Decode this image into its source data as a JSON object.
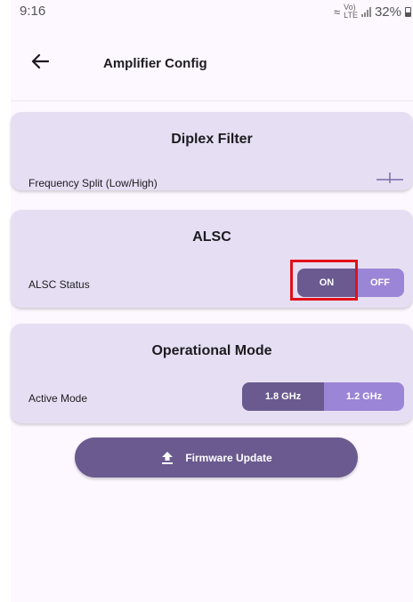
{
  "status_bar": {
    "time": "9:16",
    "network_top": "Vo)",
    "network_bottom": "LTE",
    "battery_percent": "32%"
  },
  "app_bar": {
    "title": "Amplifier Config",
    "back_icon": "arrow-left-icon"
  },
  "diplex": {
    "title": "Diplex Filter",
    "frequency_label": "Frequency Split (Low/High)"
  },
  "alsc": {
    "title": "ALSC",
    "status_label": "ALSC Status",
    "on_label": "ON",
    "off_label": "OFF",
    "selected": "ON"
  },
  "mode": {
    "title": "Operational Mode",
    "active_label": "Active Mode",
    "option_1": "1.8 GHz",
    "option_2": "1.2 GHz",
    "selected": "1.8 GHz"
  },
  "firmware": {
    "label": "Firmware Update",
    "icon": "upload-icon"
  },
  "colors": {
    "background": "#fdf7ff",
    "card": "#e6dff3",
    "primary": "#6a5a8f",
    "secondary": "#9b85d6",
    "highlight": "#e0101a"
  }
}
